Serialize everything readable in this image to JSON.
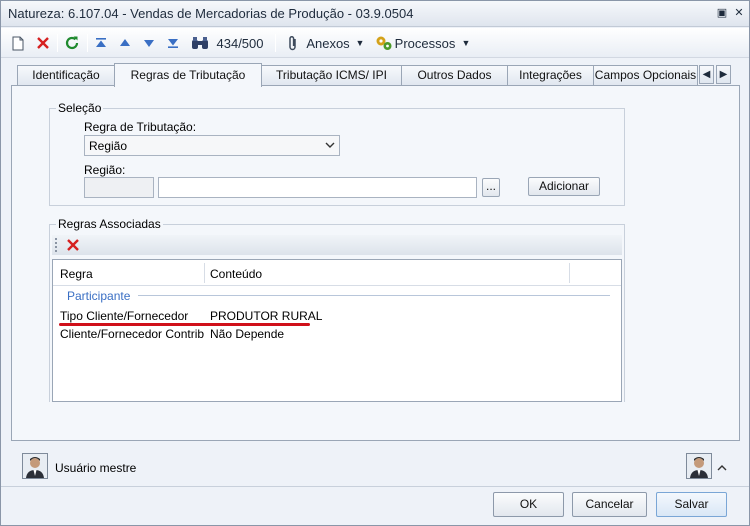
{
  "window": {
    "title": "Natureza: 6.107.04 - Vendas de Mercadorias de Produção - 03.9.0504"
  },
  "toolbar": {
    "record_counter": "434/500",
    "anexos_label": "Anexos",
    "processos_label": "Processos"
  },
  "tabs": [
    {
      "label": "Identificação"
    },
    {
      "label": "Regras de Tributação"
    },
    {
      "label": "Tributação ICMS/ IPI"
    },
    {
      "label": "Outros Dados"
    },
    {
      "label": "Integrações"
    },
    {
      "label": "Campos Opcionais"
    }
  ],
  "selecao": {
    "group_label": "Seleção",
    "regra_label": "Regra de Tributação:",
    "regra_value": "Região",
    "regiao_label": "Região:",
    "browse_label": "...",
    "add_button": "Adicionar"
  },
  "regras": {
    "group_label": "Regras Associadas",
    "columns": [
      "Regra",
      "Conteúdo"
    ],
    "group_row": "Participante",
    "rows": [
      {
        "regra": "Tipo Cliente/Fornecedor",
        "conteudo": "PRODUTOR RURAL"
      },
      {
        "regra": "Cliente/Fornecedor Contrib...",
        "conteudo": "Não Depende"
      }
    ]
  },
  "status": {
    "user": "Usuário mestre"
  },
  "footer": {
    "ok": "OK",
    "cancel": "Cancelar",
    "save": "Salvar"
  },
  "colors": {
    "accent_blue": "#3a6fc4",
    "annotation_red": "#d0101a",
    "delete_red": "#d62020"
  }
}
